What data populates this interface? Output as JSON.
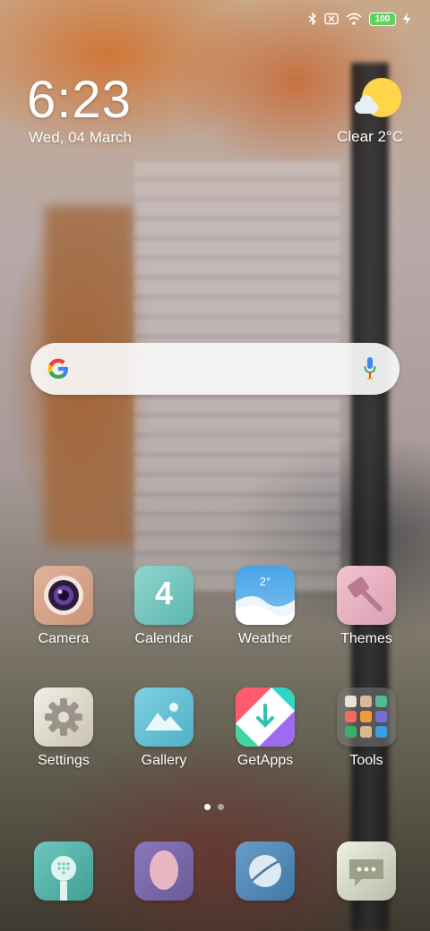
{
  "status_bar": {
    "icons": [
      "bluetooth-icon",
      "sim-no-signal-icon",
      "wifi-icon",
      "battery-icon",
      "charging-icon"
    ],
    "battery": "100",
    "battery_color": "#5cd25c"
  },
  "clock": {
    "time": "6:23",
    "date": "Wed, 04 March"
  },
  "weather_widget": {
    "condition": "Clear",
    "temperature": "2°C",
    "text": "Clear  2°C",
    "icon": "sun-cloud-icon"
  },
  "search_bar": {
    "logo": "G",
    "mic_icon": "microphone-icon"
  },
  "apps": {
    "row1": [
      {
        "label": "Camera",
        "icon": "camera-icon"
      },
      {
        "label": "Calendar",
        "icon": "calendar-icon",
        "day": "4"
      },
      {
        "label": "Weather",
        "icon": "weather-icon",
        "temp": "2°"
      },
      {
        "label": "Themes",
        "icon": "paint-brush-icon"
      }
    ],
    "row2": [
      {
        "label": "Settings",
        "icon": "gear-icon"
      },
      {
        "label": "Gallery",
        "icon": "mountains-icon"
      },
      {
        "label": "GetApps",
        "icon": "download-arrow-icon"
      },
      {
        "label": "Tools",
        "icon": "folder-icon"
      }
    ]
  },
  "page_indicator": {
    "pages": 2,
    "active": 1
  },
  "dock": [
    {
      "icon": "phone-dialer-icon"
    },
    {
      "icon": "contacts-icon"
    },
    {
      "icon": "browser-icon"
    },
    {
      "icon": "messaging-icon"
    }
  ]
}
